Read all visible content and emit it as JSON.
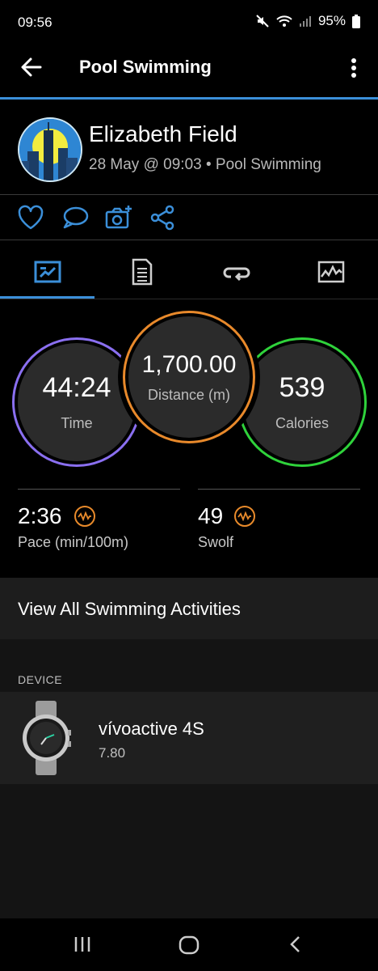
{
  "status_bar": {
    "time": "09:56",
    "battery": "95%"
  },
  "header": {
    "title": "Pool Swimming"
  },
  "profile": {
    "name": "Elizabeth Field",
    "subtitle": "28 May @ 09:03 • Pool Swimming"
  },
  "actions": [
    "heart-icon",
    "comment-icon",
    "add-photo-icon",
    "share-icon"
  ],
  "tabs": [
    "overview",
    "details",
    "laps",
    "charts"
  ],
  "metrics": {
    "time": {
      "value": "44:24",
      "label": "Time",
      "color": "#8a6ff0"
    },
    "distance": {
      "value": "1,700.00",
      "label": "Distance (m)",
      "color": "#e8892b"
    },
    "calories": {
      "value": "539",
      "label": "Calories",
      "color": "#2fd23b"
    }
  },
  "stats": {
    "pace": {
      "value": "2:36",
      "label": "Pace (min/100m)"
    },
    "swolf": {
      "value": "49",
      "label": "Swolf"
    }
  },
  "view_all": "View All Swimming Activities",
  "device": {
    "header": "DEVICE",
    "name": "vívoactive 4S",
    "version": "7.80"
  },
  "colors": {
    "accent": "#3b8fd9",
    "badge": "#e88a2b"
  }
}
